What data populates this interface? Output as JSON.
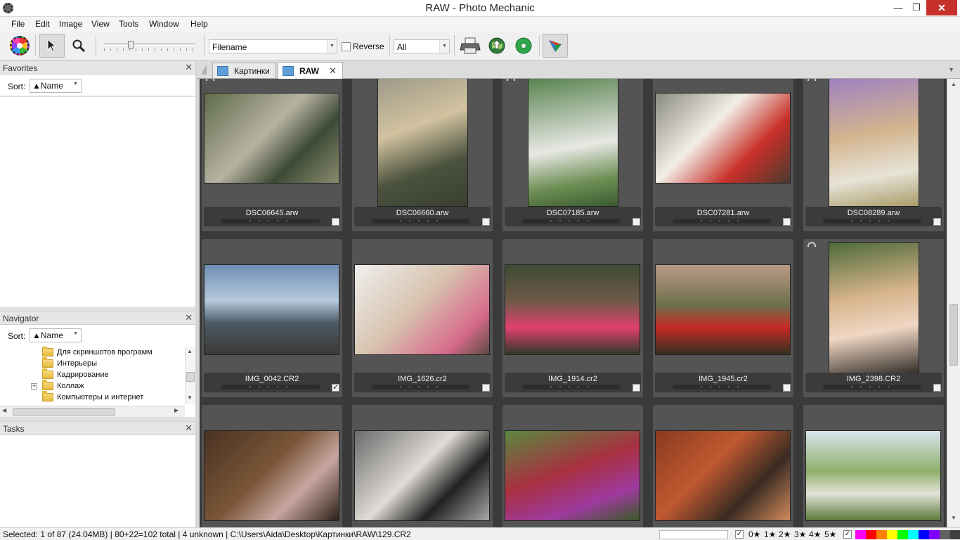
{
  "window": {
    "title": "RAW - Photo Mechanic",
    "min": "—",
    "max": "❐",
    "close": "✕"
  },
  "menu": [
    "File",
    "Edit",
    "Image",
    "View",
    "Tools",
    "Window",
    "Help"
  ],
  "toolbar": {
    "sort_field": "Filename",
    "reverse_label": "Reverse",
    "reverse_checked": false,
    "filter": "All",
    "zoom_slider_fraction": 0.28
  },
  "favorites": {
    "title": "Favorites",
    "close": "✕",
    "sort_label": "Sort:",
    "sort_value": "▲Name"
  },
  "navigator": {
    "title": "Navigator",
    "close": "✕",
    "sort_label": "Sort:",
    "sort_value": "▲Name",
    "folders": [
      "Для скриншотов программ",
      "Интерьеры",
      "Кадрирование",
      "Коллаж",
      "Компьютеры и интернет"
    ]
  },
  "tasks": {
    "title": "Tasks",
    "close": "✕"
  },
  "tabs": [
    {
      "label": "Картинки",
      "active": false
    },
    {
      "label": "RAW",
      "active": true,
      "close": "✕"
    }
  ],
  "photos": [
    {
      "name": "DSC06645.arw",
      "checked": false
    },
    {
      "name": "DSC06660.arw",
      "checked": false
    },
    {
      "name": "DSC07185.arw",
      "checked": false
    },
    {
      "name": "DSC07281.arw",
      "checked": false
    },
    {
      "name": "DSC08289.arw",
      "checked": false
    },
    {
      "name": "IMG_0042.CR2",
      "checked": true
    },
    {
      "name": "IMG_1626.cr2",
      "checked": false
    },
    {
      "name": "IMG_1914.cr2",
      "checked": false
    },
    {
      "name": "IMG_1945.cr2",
      "checked": false
    },
    {
      "name": "IMG_2398.CR2",
      "checked": false
    },
    {
      "name": "",
      "checked": false
    },
    {
      "name": "",
      "checked": false
    },
    {
      "name": "",
      "checked": false
    },
    {
      "name": "",
      "checked": false
    },
    {
      "name": "",
      "checked": false
    }
  ],
  "status": {
    "text": "Selected: 1 of 87 (24.04MB) | 80+22=102 total | 4 unknown | C:\\Users\\Aida\\Desktop\\Картинки\\RAW\\129.CR2",
    "ratings": [
      "0★",
      "1★",
      "2★",
      "3★",
      "4★",
      "5★"
    ],
    "colors": [
      "#ff00ff",
      "#ff0000",
      "#ff8000",
      "#ffff00",
      "#00ff00",
      "#00ffff",
      "#0000ff",
      "#8000ff",
      "#606060",
      "#404040"
    ]
  },
  "colors": {
    "grid_bg": "#3a3a3a",
    "cell_bg": "#545454",
    "accent_close": "#c7312b"
  }
}
